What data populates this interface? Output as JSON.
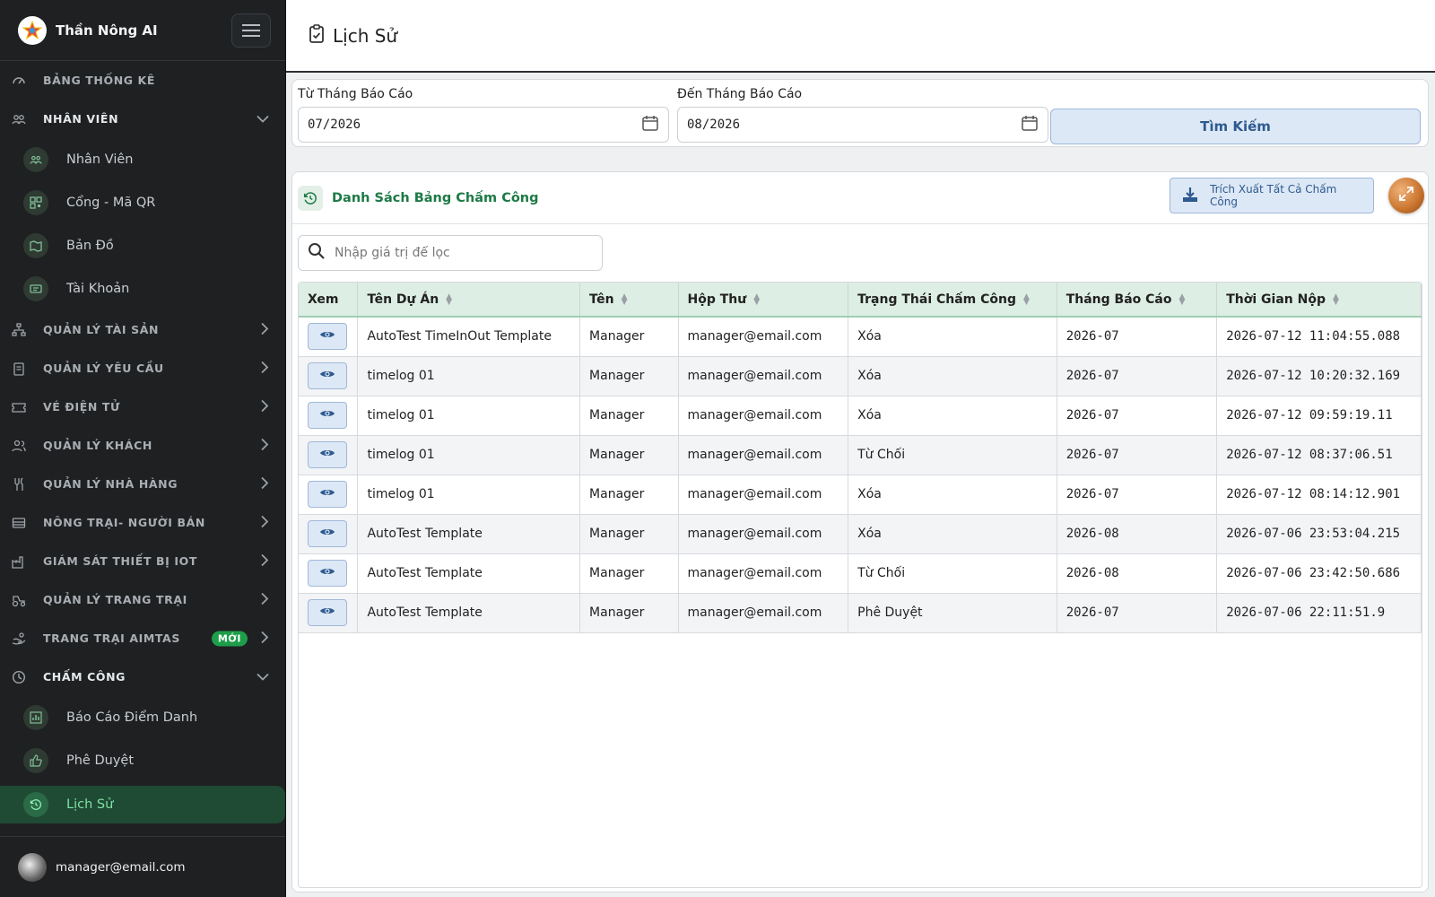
{
  "app": {
    "brand_name": "Thần Nông AI"
  },
  "sidebar": {
    "groups": [
      {
        "label": "BẢNG THỐNG KÊ"
      },
      {
        "label": "NHÂN VIÊN"
      },
      {
        "label": "QUẢN LÝ TÀI SẢN"
      },
      {
        "label": "QUẢN LÝ YÊU CẦU"
      },
      {
        "label": "VÉ ĐIỆN TỬ"
      },
      {
        "label": "QUẢN LÝ KHÁCH"
      },
      {
        "label": "QUẢN LÝ NHÀ HÀNG"
      },
      {
        "label": "NÔNG TRẠI- NGƯỜI BÁN"
      },
      {
        "label": "GIÁM SÁT THIẾT BỊ IOT"
      },
      {
        "label": "QUẢN LÝ TRANG TRẠI"
      },
      {
        "label": "TRANG TRẠI AIMTAS",
        "badge": "MỚI"
      },
      {
        "label": "CHẤM CÔNG"
      }
    ],
    "nhan_vien_items": [
      {
        "label": "Nhân Viên"
      },
      {
        "label": "Cổng - Mã QR"
      },
      {
        "label": "Bản Đồ"
      },
      {
        "label": "Tài Khoản"
      }
    ],
    "cham_cong_items": [
      {
        "label": "Báo Cáo Điểm Danh"
      },
      {
        "label": "Phê Duyệt"
      },
      {
        "label": "Lịch Sử"
      }
    ],
    "footer_email": "manager@email.com"
  },
  "header": {
    "title": "Lịch Sử"
  },
  "filters": {
    "from_label": "Từ Tháng Báo Cáo",
    "from_value": "07/2026",
    "to_label": "Đến Tháng Báo Cáo",
    "to_value": "08/2026",
    "search_label": "Tìm Kiếm"
  },
  "list": {
    "title": "Danh Sách Bảng Chấm Công",
    "export_label": "Trích Xuất Tất Cả Chấm Công",
    "filter_placeholder": "Nhập giá trị để lọc",
    "columns": [
      "Xem",
      "Tên Dự Án",
      "Tên",
      "Hộp Thư",
      "Trạng Thái Chấm Công",
      "Tháng Báo Cáo",
      "Thời Gian Nộp"
    ],
    "rows": [
      {
        "project": "AutoTest TimeInOut Template",
        "name": "Manager",
        "email": "manager@email.com",
        "status": "Xóa",
        "month": "2026-07",
        "submitted": "2026-07-12 11:04:55.088"
      },
      {
        "project": "timelog 01",
        "name": "Manager",
        "email": "manager@email.com",
        "status": "Xóa",
        "month": "2026-07",
        "submitted": "2026-07-12 10:20:32.169"
      },
      {
        "project": "timelog 01",
        "name": "Manager",
        "email": "manager@email.com",
        "status": "Xóa",
        "month": "2026-07",
        "submitted": "2026-07-12 09:59:19.11"
      },
      {
        "project": "timelog 01",
        "name": "Manager",
        "email": "manager@email.com",
        "status": "Từ Chối",
        "month": "2026-07",
        "submitted": "2026-07-12 08:37:06.51"
      },
      {
        "project": "timelog 01",
        "name": "Manager",
        "email": "manager@email.com",
        "status": "Xóa",
        "month": "2026-07",
        "submitted": "2026-07-12 08:14:12.901"
      },
      {
        "project": "AutoTest Template",
        "name": "Manager",
        "email": "manager@email.com",
        "status": "Xóa",
        "month": "2026-08",
        "submitted": "2026-07-06 23:53:04.215"
      },
      {
        "project": "AutoTest Template",
        "name": "Manager",
        "email": "manager@email.com",
        "status": "Từ Chối",
        "month": "2026-08",
        "submitted": "2026-07-06 23:42:50.686"
      },
      {
        "project": "AutoTest Template",
        "name": "Manager",
        "email": "manager@email.com",
        "status": "Phê Duyệt",
        "month": "2026-07",
        "submitted": "2026-07-06 22:11:51.9"
      }
    ]
  },
  "colors": {
    "sidebar_bg": "#1e2022",
    "accent_green": "#1d7a46",
    "active_item_bg": "#1f4a33",
    "button_blue_bg": "#dde8f6",
    "button_blue_text": "#2e5a8f",
    "header_row_bg": "#ddeee4"
  }
}
